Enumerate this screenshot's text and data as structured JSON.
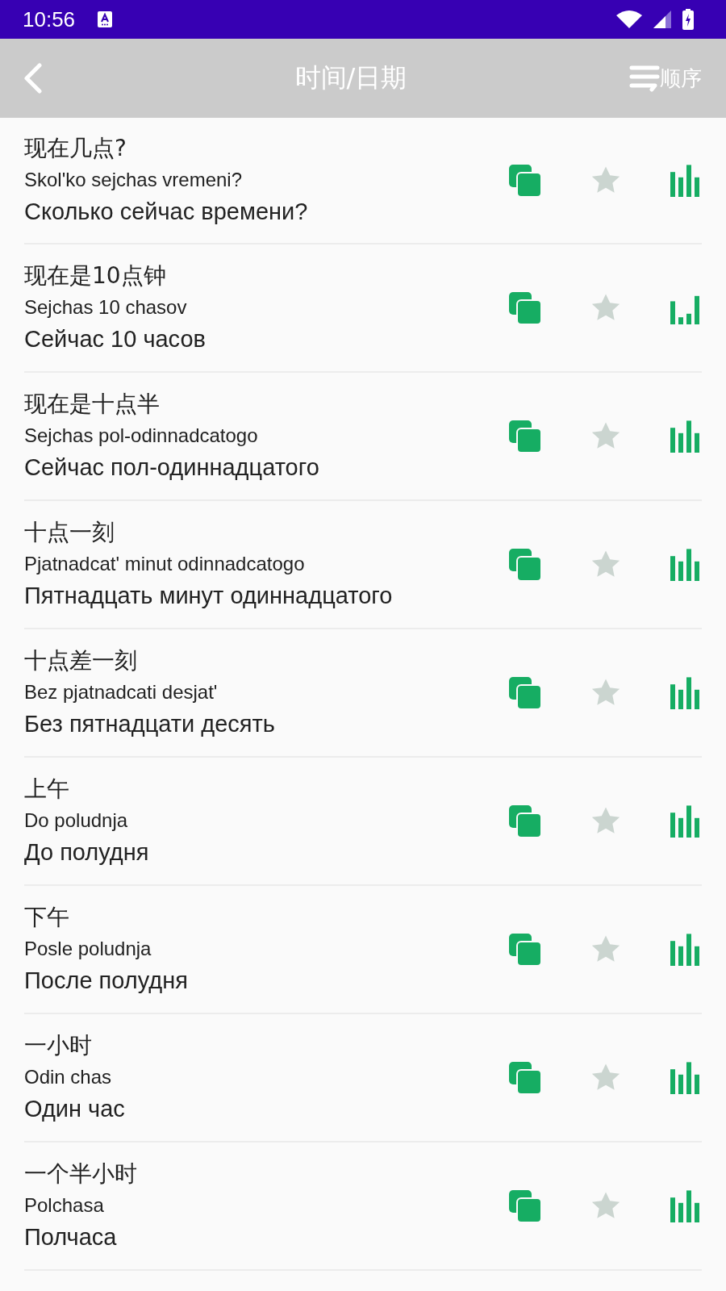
{
  "status_bar": {
    "time": "10:56"
  },
  "header": {
    "title": "时间/日期",
    "sort_label": "顺序"
  },
  "phrases": [
    {
      "chinese": "现在几点?",
      "transliteration": "Skol'ko sejchas vremeni?",
      "russian": "Сколько сейчас времени?",
      "favorite": false,
      "kind": "full"
    },
    {
      "chinese": "现在是10点钟",
      "transliteration": "Sejchas 10 chasov",
      "russian": "Сейчас 10 часов",
      "favorite": false,
      "kind": "partial"
    },
    {
      "chinese": "现在是十点半",
      "transliteration": "Sejchas pol-odinnadcatogo",
      "russian": "Сейчас пол-одиннадцатого",
      "favorite": false,
      "kind": "full"
    },
    {
      "chinese": "十点一刻",
      "transliteration": "Pjatnadcat' minut odinnadcatogo",
      "russian": "Пятнадцать минут одиннадцатого",
      "favorite": false,
      "kind": "full"
    },
    {
      "chinese": "十点差一刻",
      "transliteration": "Bez pjatnadcati desjat'",
      "russian": "Без пятнадцати десять",
      "favorite": false,
      "kind": "full"
    },
    {
      "chinese": "上午",
      "transliteration": "Do poludnja",
      "russian": "До полудня",
      "favorite": false,
      "kind": "full"
    },
    {
      "chinese": "下午",
      "transliteration": "Posle poludnja",
      "russian": "После полудня",
      "favorite": false,
      "kind": "full"
    },
    {
      "chinese": "一小时",
      "transliteration": "Odin chas",
      "russian": "Один час",
      "favorite": false,
      "kind": "full"
    },
    {
      "chinese": "一个半小时",
      "transliteration": "Polchasa",
      "russian": "Полчаса",
      "favorite": false,
      "kind": "full"
    }
  ]
}
